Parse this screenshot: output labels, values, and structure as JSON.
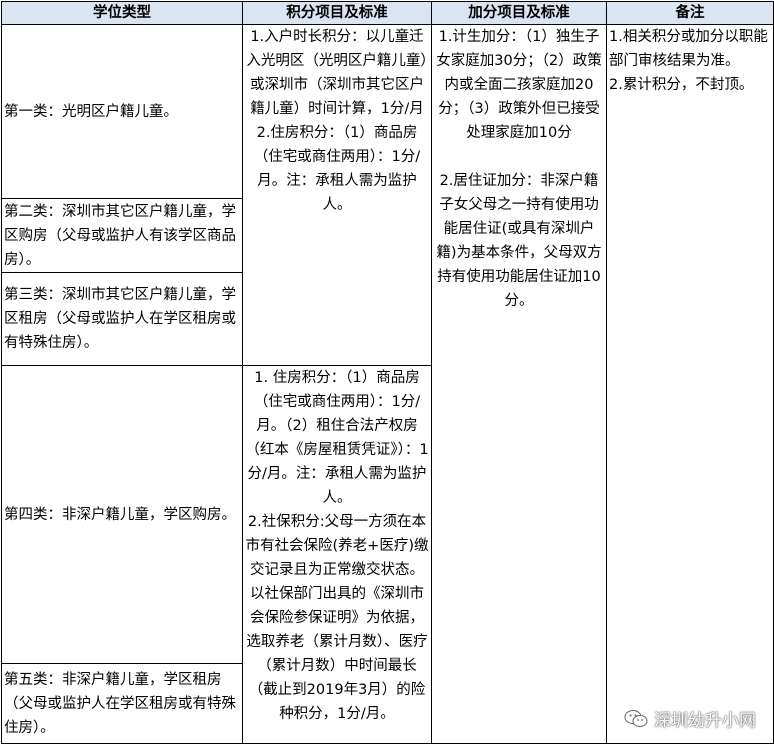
{
  "table": {
    "headers": [
      "学位类型",
      "积分项目及标准",
      "加分项目及标准",
      "备注"
    ],
    "categories": [
      "第一类：光明区户籍儿童。",
      "第二类：深圳市其它区户籍儿童，学区购房（父母或监护人有该学区商品房）。",
      "第三类：深圳市其它区户籍儿童，学区租房（父母或监护人在学区租房或有特殊住房）。",
      "第四类：非深户籍儿童，学区购房。",
      "第五类：非深户籍儿童，学区租房（父母或监护人在学区租房或有特殊住房）。"
    ],
    "points_top": [
      "1.入户时长积分：以儿童迁入光明区（光明区户籍儿童）或深圳市（深圳市其它区户籍儿童）时间计算，1分/月",
      "2.住房积分：（1）商品房（住宅或商住两用）：1分/月。注：承租人需为监护人。"
    ],
    "points_bottom": [
      "1. 住房积分：（1）商品房（住宅或商住两用）：1分/月。（2）租住合法产权房（红本《房屋租赁凭证》）：1分/月。注：承租人需为监护人。",
      "2.社保积分:父母一方须在本市有社会保险(养老+医疗)缴交记录且为正常缴交状态。以社保部门出具的《深圳市会保险参保证明》为依据，选取养老（累计月数）、医疗（累计月数）中时间最长（截止到2019年3月）的险种积分，1分/月。"
    ],
    "bonus": [
      "1.计生加分：（1）独生子女家庭加30分；（2）政策内或全面二孩家庭加20分；（3）政策外但已接受处理家庭加10分",
      "2.居住证加分：非深户籍子女父母之一持有使用功能居住证(或具有深圳户籍)为基本条件，父母双方持有使用功能居住证加10分。"
    ],
    "remarks": [
      "1.相关积分或加分以职能部门审核结果为准。",
      "2.累计积分，不封顶。"
    ]
  },
  "watermark": {
    "text": "深圳幼升小网",
    "icon": "wechat-icon"
  }
}
